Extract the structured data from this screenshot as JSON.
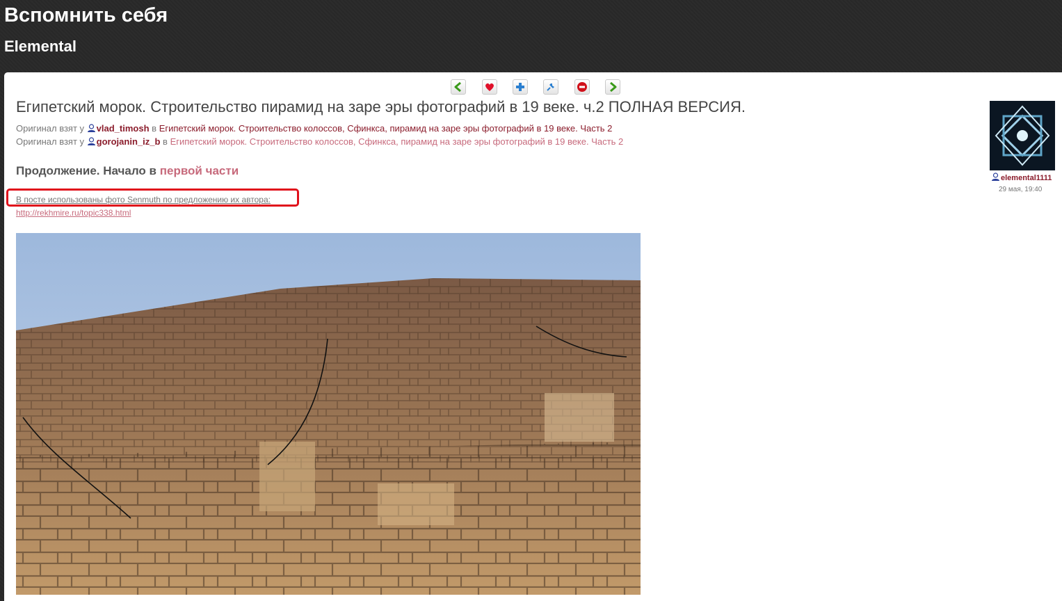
{
  "header": {
    "blog_title": "Вспомнить себя",
    "blog_subtitle": "Elemental"
  },
  "toolbar": [
    {
      "name": "prev-entry-button",
      "icon": "arrow-left-icon",
      "color": "#3a9a1a"
    },
    {
      "name": "memories-button",
      "icon": "heart-icon",
      "color": "#e0102a"
    },
    {
      "name": "add-button",
      "icon": "plus-icon",
      "color": "#2a7fd0"
    },
    {
      "name": "tag-button",
      "icon": "pin-icon",
      "color": "#2a7fd0"
    },
    {
      "name": "flag-button",
      "icon": "minus-circle-icon",
      "color": "#d0101a"
    },
    {
      "name": "next-entry-button",
      "icon": "arrow-right-icon",
      "color": "#3a9a1a"
    }
  ],
  "post": {
    "title": "Египетский морок. Строительство пирамид на заре эры фотографий в 19 веке. ч.2 ПОЛНАЯ ВЕРСИЯ.",
    "originals": [
      {
        "prefix": "Оригинал взят у",
        "user": "vlad_timosh",
        "in": "в",
        "link": "Египетский морок. Строительство колоссов, Сфинкса, пирамид на заре эры фотографий в 19 веке. Часть 2"
      },
      {
        "prefix": "Оригинал взят у",
        "user": "gorojanin_iz_b",
        "in": "в",
        "link": "Египетский морок. Строительство колоссов, Сфинкса, пирамид на заре эры фотографий в 19 веке. Часть 2"
      }
    ],
    "continuation": {
      "text": "Продолжение. Начало в",
      "link": "первой части"
    },
    "note": {
      "text": "В посте использованы фото Senmuth по предложению их автора",
      "colon": ":",
      "url": "http://rekhmire.ru/topic338.html"
    }
  },
  "author": {
    "name": "elemental1111",
    "date": "29 мая, 19:40"
  },
  "colors": {
    "accent": "#8b1d2c",
    "link_light": "#c76a7c",
    "highlight_box": "#e0101b"
  }
}
